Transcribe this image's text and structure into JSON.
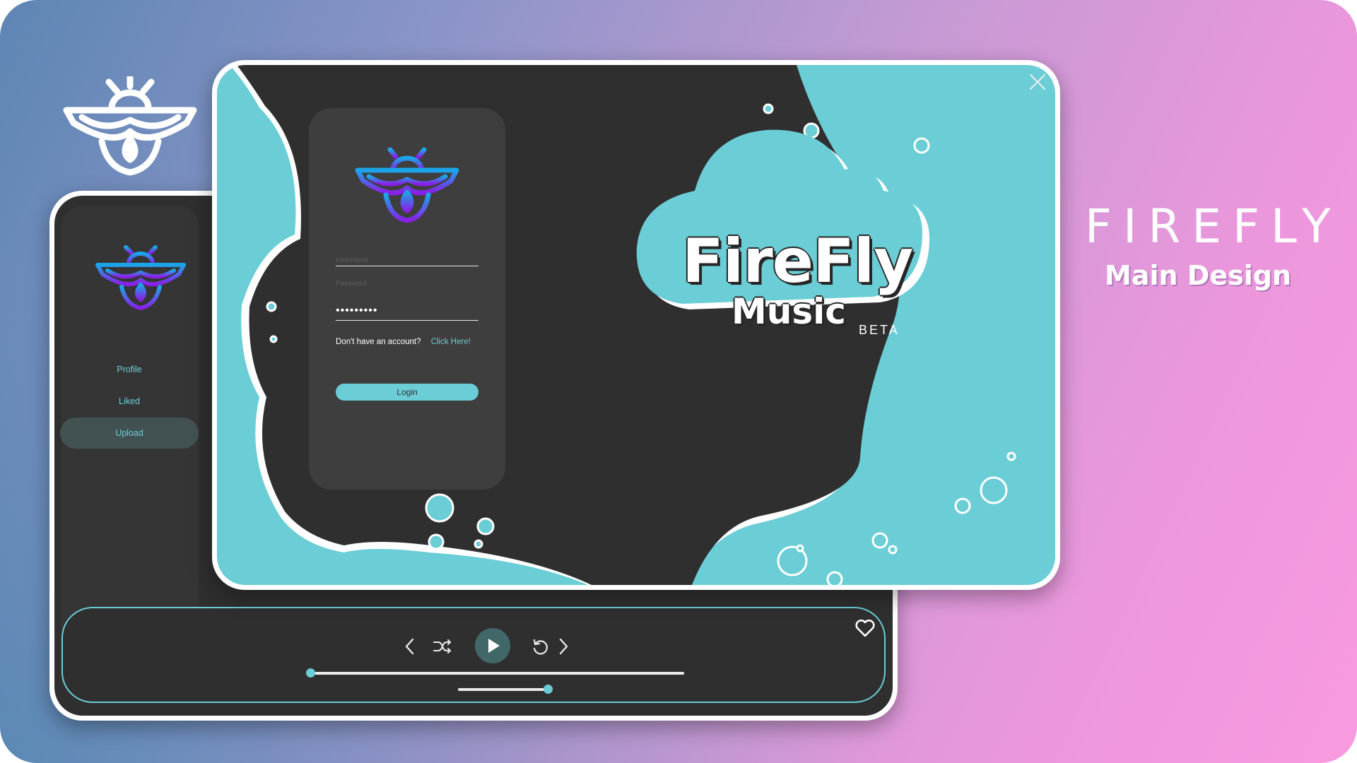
{
  "colors": {
    "accent": "#6bcdd6",
    "panel_dark": "#2f2f2f",
    "card": "#3e3e3e",
    "sidebar": "#353535",
    "active_item": "#425253",
    "logo_gradient_start": "#1aa6e8",
    "logo_gradient_end": "#8a1fe6"
  },
  "showcase": {
    "title": "FIREFLY",
    "subtitle": "Main Design"
  },
  "login": {
    "username_placeholder": "Username",
    "password_placeholder": "Password",
    "password_value": "•••••••••",
    "signup_prompt": "Don't have an account?",
    "signup_link": "Click Here!",
    "login_button": "Login"
  },
  "brand": {
    "name": "FireFly",
    "product": "Music",
    "badge": "BETA"
  },
  "sidebar": {
    "items": [
      {
        "label": "Profile",
        "active": false
      },
      {
        "label": "Liked",
        "active": false
      },
      {
        "label": "Upload",
        "active": true
      }
    ]
  },
  "player": {
    "progress": 0.0,
    "volume": 0.85
  },
  "icons": [
    "firefly-logo-icon",
    "close-icon",
    "previous-icon",
    "shuffle-icon",
    "play-icon",
    "repeat-icon",
    "next-icon",
    "heart-icon"
  ]
}
